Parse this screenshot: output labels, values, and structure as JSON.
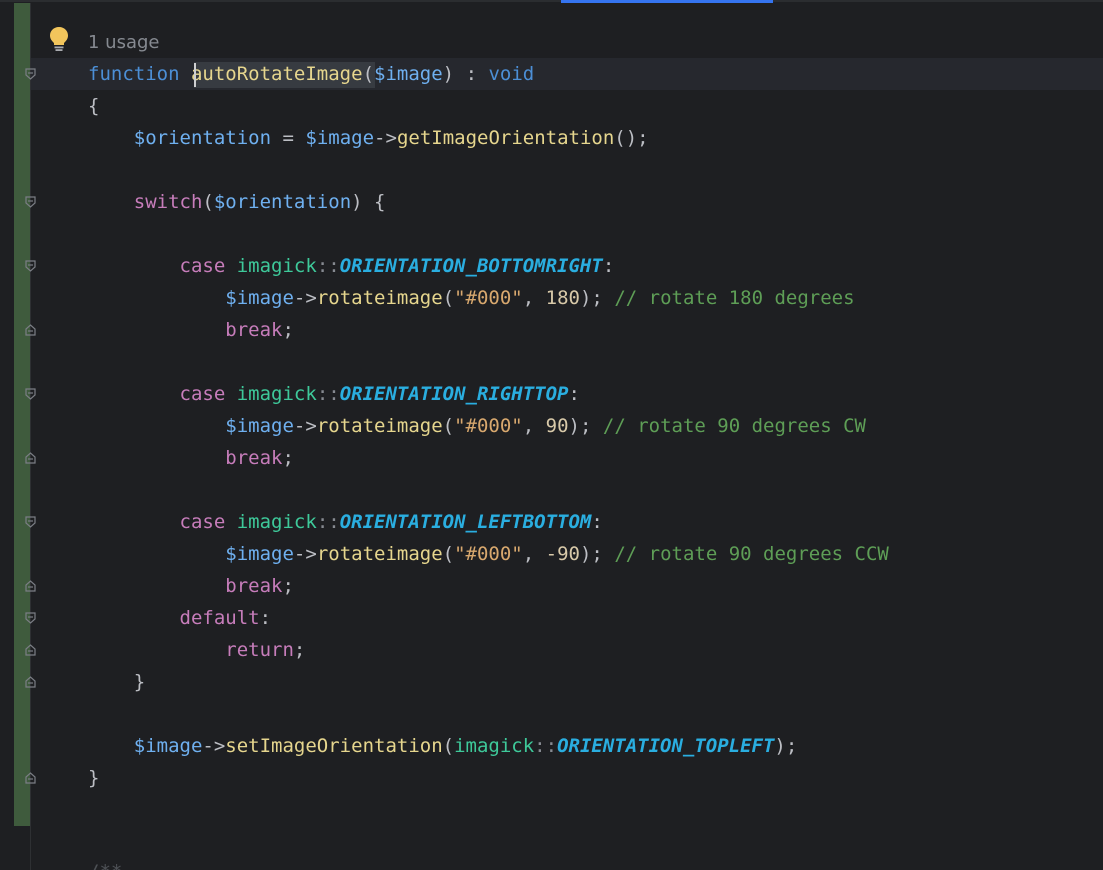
{
  "editor": {
    "usage_hint": "1 usage",
    "caret_line": 2,
    "lines": {
      "l2": {
        "kw": "function",
        "name": "autoRotateImage",
        "param": "$image",
        "ret_sep": ":",
        "ret_type": "void"
      },
      "l3": {
        "brace": "{"
      },
      "l4": {
        "var": "$orientation",
        "assign": "=",
        "obj": "$image",
        "arrow": "->",
        "method": "getImageOrientation",
        "tail": "();"
      },
      "l6": {
        "kw": "switch",
        "open": "(",
        "var": "$orientation",
        "close": ") {"
      },
      "l8": {
        "kw": "case",
        "cls": "imagick",
        "sep": "::",
        "const": "ORIENTATION_BOTTOMRIGHT",
        "colon": ":"
      },
      "l9": {
        "obj": "$image",
        "arrow": "->",
        "method": "rotateimage",
        "open": "(",
        "str": "\"#000\"",
        "comma": ", ",
        "num": "180",
        "close": ");",
        "comment": "// rotate 180 degrees"
      },
      "l10": {
        "kw": "break",
        "semi": ";"
      },
      "l12": {
        "kw": "case",
        "cls": "imagick",
        "sep": "::",
        "const": "ORIENTATION_RIGHTTOP",
        "colon": ":"
      },
      "l13": {
        "obj": "$image",
        "arrow": "->",
        "method": "rotateimage",
        "open": "(",
        "str": "\"#000\"",
        "comma": ", ",
        "num": "90",
        "close": ");",
        "comment": "// rotate 90 degrees CW"
      },
      "l14": {
        "kw": "break",
        "semi": ";"
      },
      "l16": {
        "kw": "case",
        "cls": "imagick",
        "sep": "::",
        "const": "ORIENTATION_LEFTBOTTOM",
        "colon": ":"
      },
      "l17": {
        "obj": "$image",
        "arrow": "->",
        "method": "rotateimage",
        "open": "(",
        "str": "\"#000\"",
        "comma": ", ",
        "num": "-90",
        "close": ");",
        "comment": "// rotate 90 degrees CCW"
      },
      "l18": {
        "kw": "break",
        "semi": ";"
      },
      "l19": {
        "kw": "default",
        "colon": ":"
      },
      "l20": {
        "kw": "return",
        "semi": ";"
      },
      "l21": {
        "brace": "}"
      },
      "l23": {
        "obj": "$image",
        "arrow": "->",
        "method": "setImageOrientation",
        "open": "(",
        "cls": "imagick",
        "sep": "::",
        "const": "ORIENTATION_TOPLEFT",
        "close": ");"
      },
      "l24": {
        "brace": "}"
      },
      "l27": {
        "text": "/**"
      }
    }
  },
  "colors": {
    "background": "#1e1f22",
    "keyword": "#4c8fd6",
    "control": "#c77dbb",
    "variable": "#6fb0f0",
    "method": "#e6d68e",
    "class": "#3ec99a",
    "constant": "#2aaee0",
    "string": "#d8a86e",
    "comment": "#5e9e56",
    "vcs_changed": "#3f5b3d",
    "tab_indicator": "#3574f0"
  },
  "icons": {
    "hint": "lightbulb-icon",
    "fold_open": "fold-open-icon",
    "fold_close": "fold-close-icon"
  }
}
